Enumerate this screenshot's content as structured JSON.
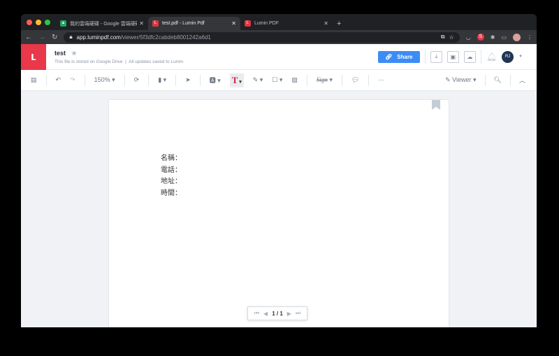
{
  "browser": {
    "tabs": [
      {
        "label": "我的雲端硬碟 - Google 雲端硬碟",
        "active": false
      },
      {
        "label": "test.pdf - Lumin Pdf",
        "active": true
      },
      {
        "label": "Lumin PDF",
        "active": false
      }
    ],
    "url_host": "app.luminpdf.com",
    "url_path": "/viewer/5f3dfc2cabdeb8001242a6d1",
    "profile_badge": "S"
  },
  "header": {
    "title": "test",
    "storage_note": "This file is stored on Google Drive",
    "save_status": "All updates saved to Lumin",
    "share_label": "Share",
    "avatar": "RJ",
    "brand_color": "#e8384a",
    "accent": "#3b8cf5"
  },
  "toolbar": {
    "zoom": "150%",
    "sign": "Sign",
    "mode": "Viewer"
  },
  "document": {
    "lines": [
      "名稱：",
      "電話：",
      "地址：",
      "時間："
    ]
  },
  "pager": {
    "current": "1 / 1"
  }
}
